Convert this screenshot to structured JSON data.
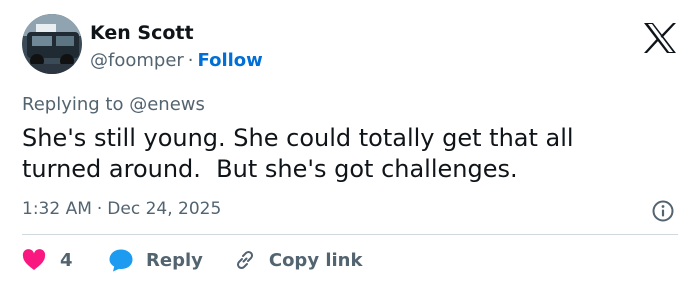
{
  "author": {
    "name": "Ken Scott",
    "handle": "@foomper",
    "separator": "·",
    "follow_label": "Follow"
  },
  "reply_context": {
    "prefix": "Replying to",
    "mention": "@enews"
  },
  "tweet": {
    "text": "She's still young. She could totally get that all\nturned around.  But she's got challenges.",
    "time": "1:32 AM",
    "separator": "·",
    "date": "Dec 24, 2025"
  },
  "actions": {
    "like_count": "4",
    "reply_label": "Reply",
    "copy_label": "Copy link"
  },
  "colors": {
    "text": "#0f1419",
    "muted": "#536471",
    "link": "#006fd6",
    "like": "#f91880",
    "reply": "#1d9bf0",
    "divider": "#cfd9de"
  },
  "icons": {
    "brand": "x-logo-icon",
    "info": "info-icon",
    "like": "heart-icon",
    "reply": "reply-bubble-icon",
    "copy": "link-icon"
  }
}
